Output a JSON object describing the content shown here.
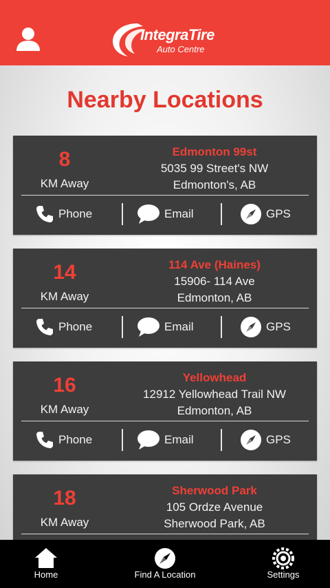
{
  "header": {
    "logo_line1": "IntegraTire",
    "logo_line2": "Auto Centre",
    "brand_color": "#ee4036"
  },
  "page": {
    "title": "Nearby Locations"
  },
  "locations": [
    {
      "distance": "8",
      "unit": "KM Away",
      "name": "Edmonton 99st",
      "address1": "5035 99 Street's NW",
      "address2": "Edmonton's, AB"
    },
    {
      "distance": "14",
      "unit": "KM Away",
      "name": "114 Ave (Haines)",
      "address1": "15906- 114 Ave",
      "address2": "Edmonton, AB"
    },
    {
      "distance": "16",
      "unit": "KM Away",
      "name": "Yellowhead",
      "address1": "12912 Yellowhead Trail NW",
      "address2": "Edmonton, AB"
    },
    {
      "distance": "18",
      "unit": "KM Away",
      "name": "Sherwood Park",
      "address1": "105 Ordze Avenue",
      "address2": "Sherwood Park, AB"
    }
  ],
  "actions": {
    "phone": "Phone",
    "email": "Email",
    "gps": "GPS"
  },
  "icons": {
    "user": "user-icon",
    "phone": "phone-icon",
    "email": "chat-bubble-icon",
    "gps": "compass-icon",
    "home": "home-icon",
    "find": "compass-icon",
    "settings": "gear-icon"
  },
  "tabbar": {
    "home": "Home",
    "find": "Find A Location",
    "settings": "Settings"
  }
}
